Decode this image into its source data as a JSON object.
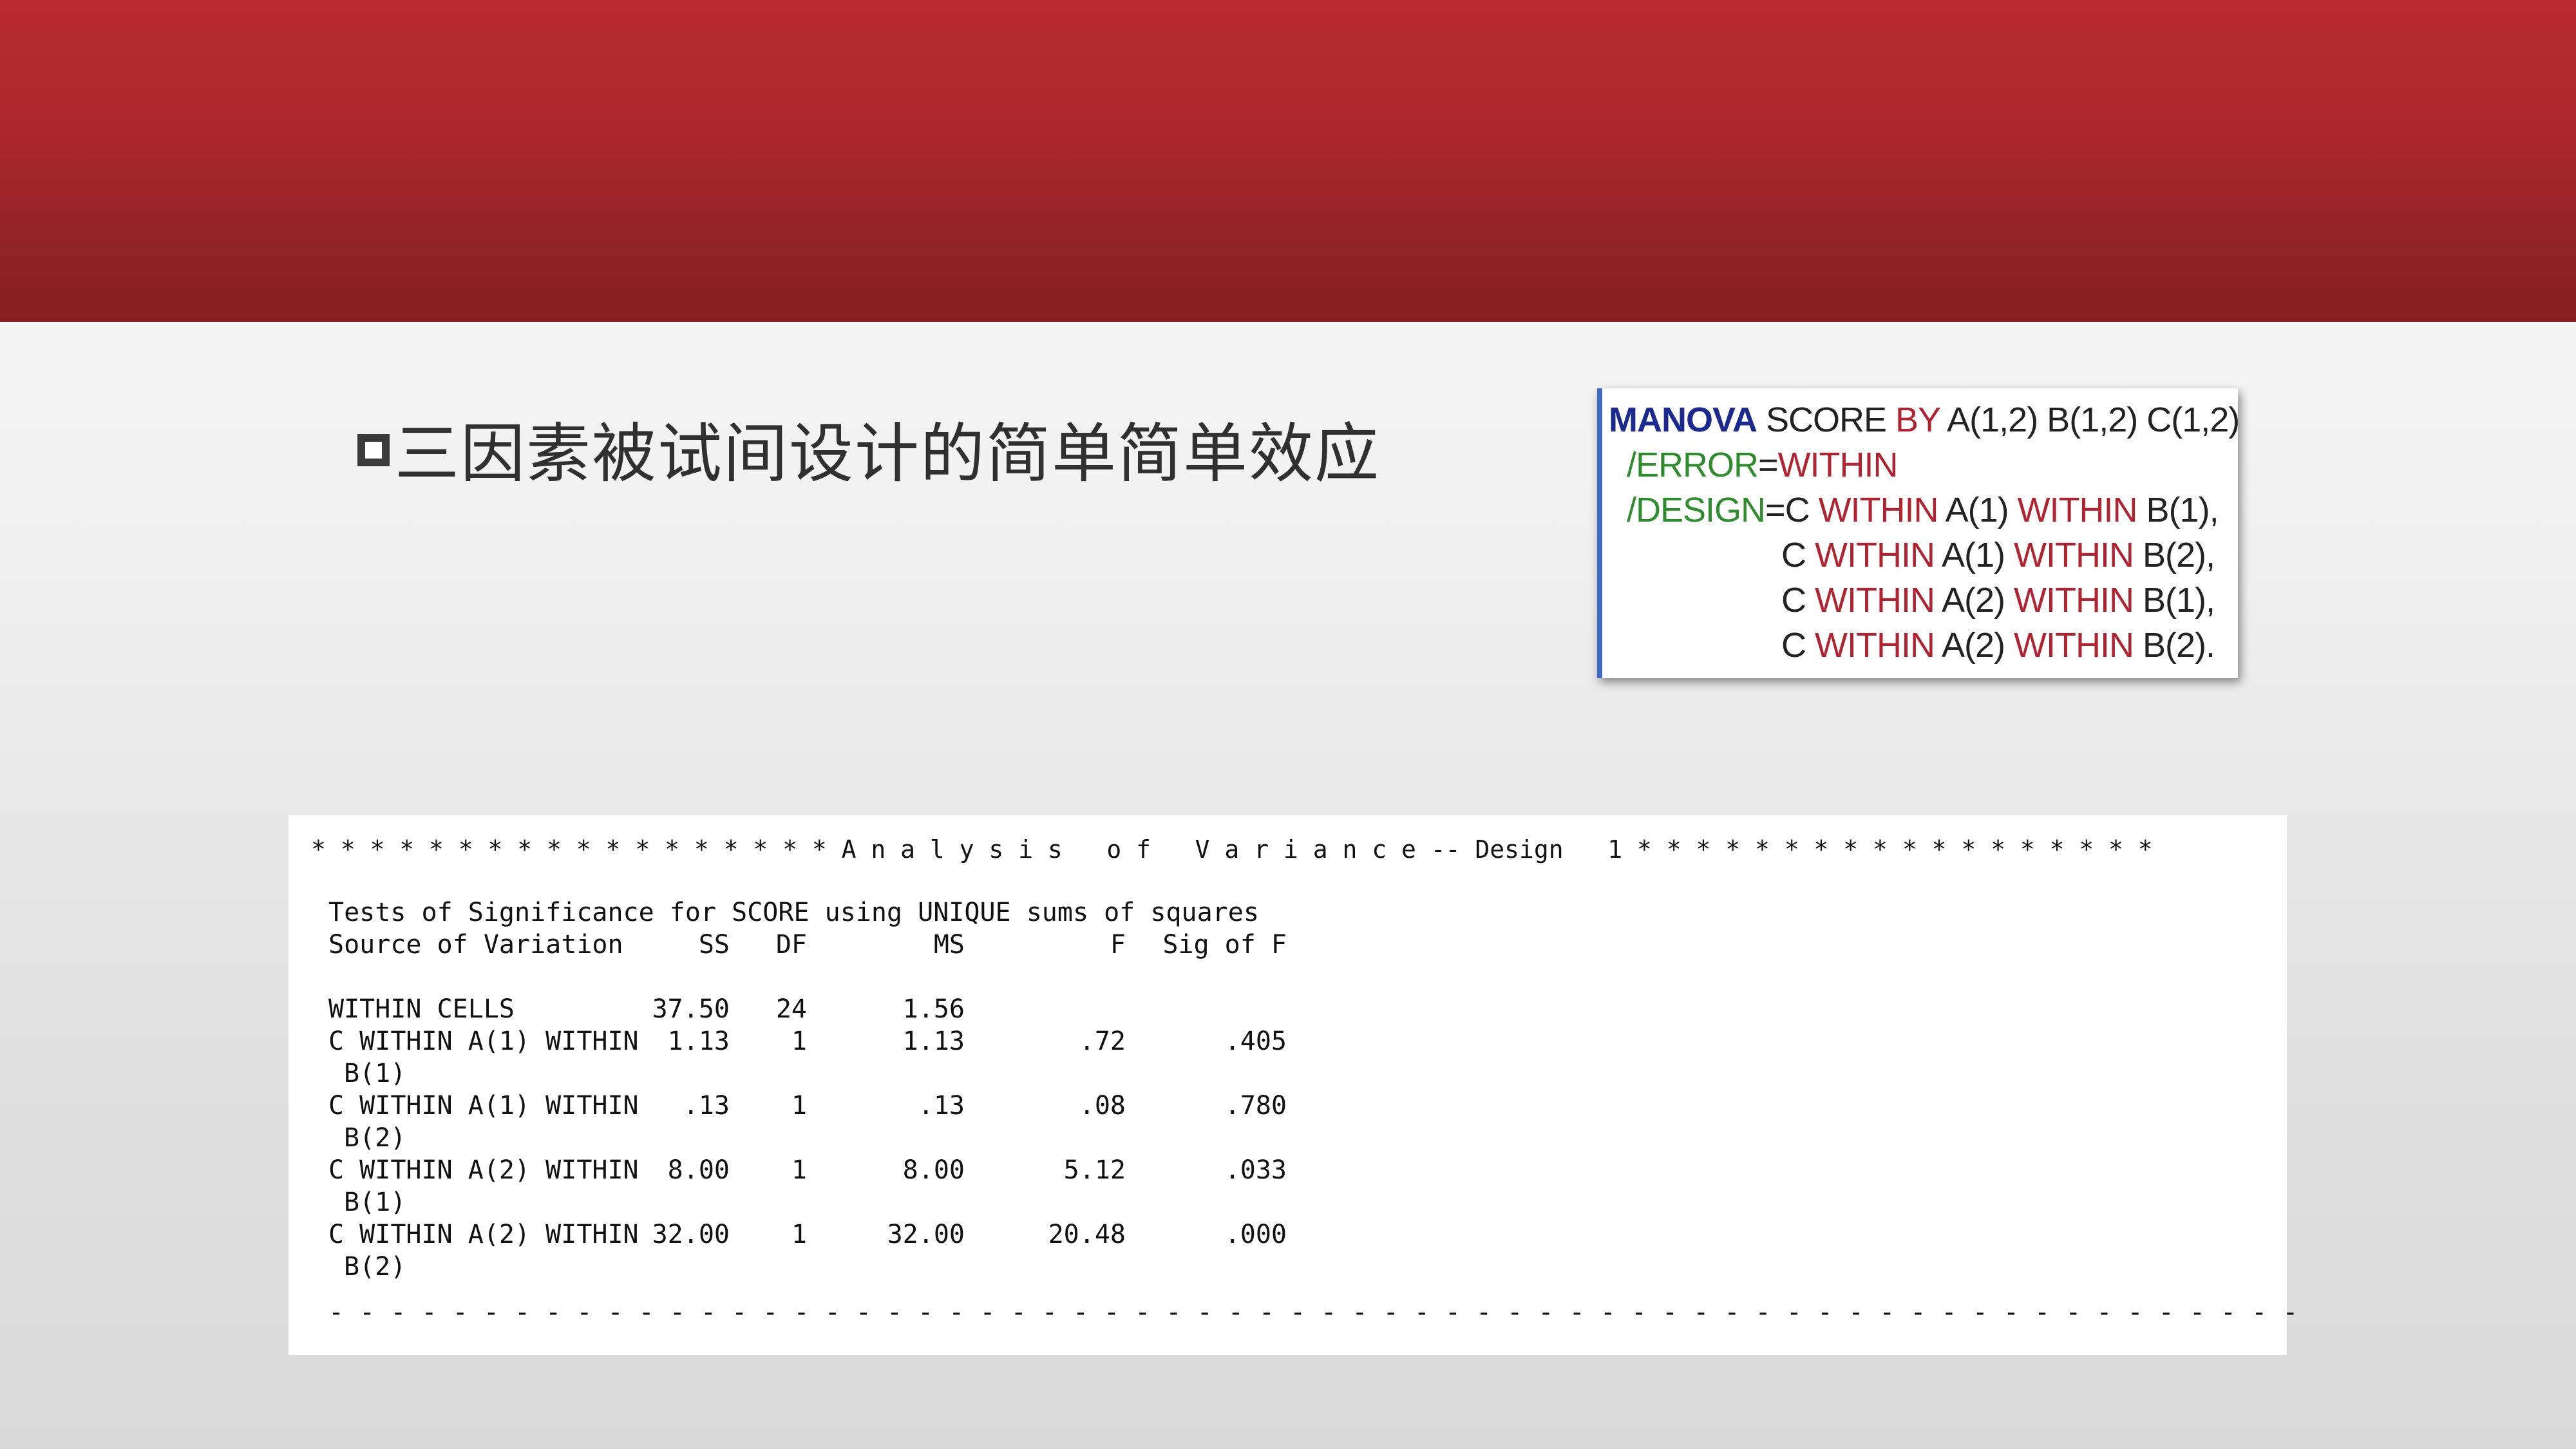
{
  "slide": {
    "title": "三因素被试间设计的简单简单效应"
  },
  "syntax": {
    "line1": {
      "manova": "MANOVA",
      "score": " SCORE ",
      "by": "BY",
      "factors": " A(1,2) B(1,2) C(1,2)"
    },
    "line2": {
      "error": "/ERROR",
      "eq": "=",
      "within": "WITHIN"
    },
    "line3": {
      "design": "/DESIGN",
      "eq": "=",
      "c": "C ",
      "within1": "WITHIN",
      "a": " A(1) ",
      "within2": "WITHIN",
      "b": " B(1),"
    },
    "line4": {
      "c": "C ",
      "within1": "WITHIN",
      "a": " A(1) ",
      "within2": "WITHIN",
      "b": " B(2),"
    },
    "line5": {
      "c": "C ",
      "within1": "WITHIN",
      "a": " A(2) ",
      "within2": "WITHIN",
      "b": " B(1),"
    },
    "line6": {
      "c": "C ",
      "within1": "WITHIN",
      "a": " A(2) ",
      "within2": "WITHIN",
      "b": " B(2)."
    }
  },
  "output": {
    "banner": "* * * * * * * * * * * * * * * * * * A n a l y s i s   o f   V a r i a n c e -- Design   1 * * * * * * * * * * * * * * * * * *",
    "heading": "Tests of Significance for SCORE using UNIQUE sums of squares",
    "columns": {
      "source": "Source of Variation",
      "ss": "SS",
      "df": "DF",
      "ms": "MS",
      "f": "F",
      "sig": "Sig of F"
    },
    "rows": [
      {
        "source": "WITHIN CELLS",
        "cont": "",
        "ss": "37.50",
        "df": "24",
        "ms": "1.56",
        "f": "",
        "sig": ""
      },
      {
        "source": "C WITHIN A(1) WITHIN",
        "cont": "B(1)",
        "ss": "1.13",
        "df": "1",
        "ms": "1.13",
        "f": ".72",
        "sig": ".405"
      },
      {
        "source": "C WITHIN A(1) WITHIN",
        "cont": "B(2)",
        "ss": ".13",
        "df": "1",
        "ms": ".13",
        "f": ".08",
        "sig": ".780"
      },
      {
        "source": "C WITHIN A(2) WITHIN",
        "cont": "B(1)",
        "ss": "8.00",
        "df": "1",
        "ms": "8.00",
        "f": "5.12",
        "sig": ".033"
      },
      {
        "source": "C WITHIN A(2) WITHIN",
        "cont": "B(2)",
        "ss": "32.00",
        "df": "1",
        "ms": "32.00",
        "f": "20.48",
        "sig": ".000"
      }
    ],
    "footer_rule": "- - - - - - - - - - - - - - - - - - - - - - - - - - - - - - - - - - - - - - - - - - - - - - - - - - - - - - - - - - - - - - - -"
  }
}
